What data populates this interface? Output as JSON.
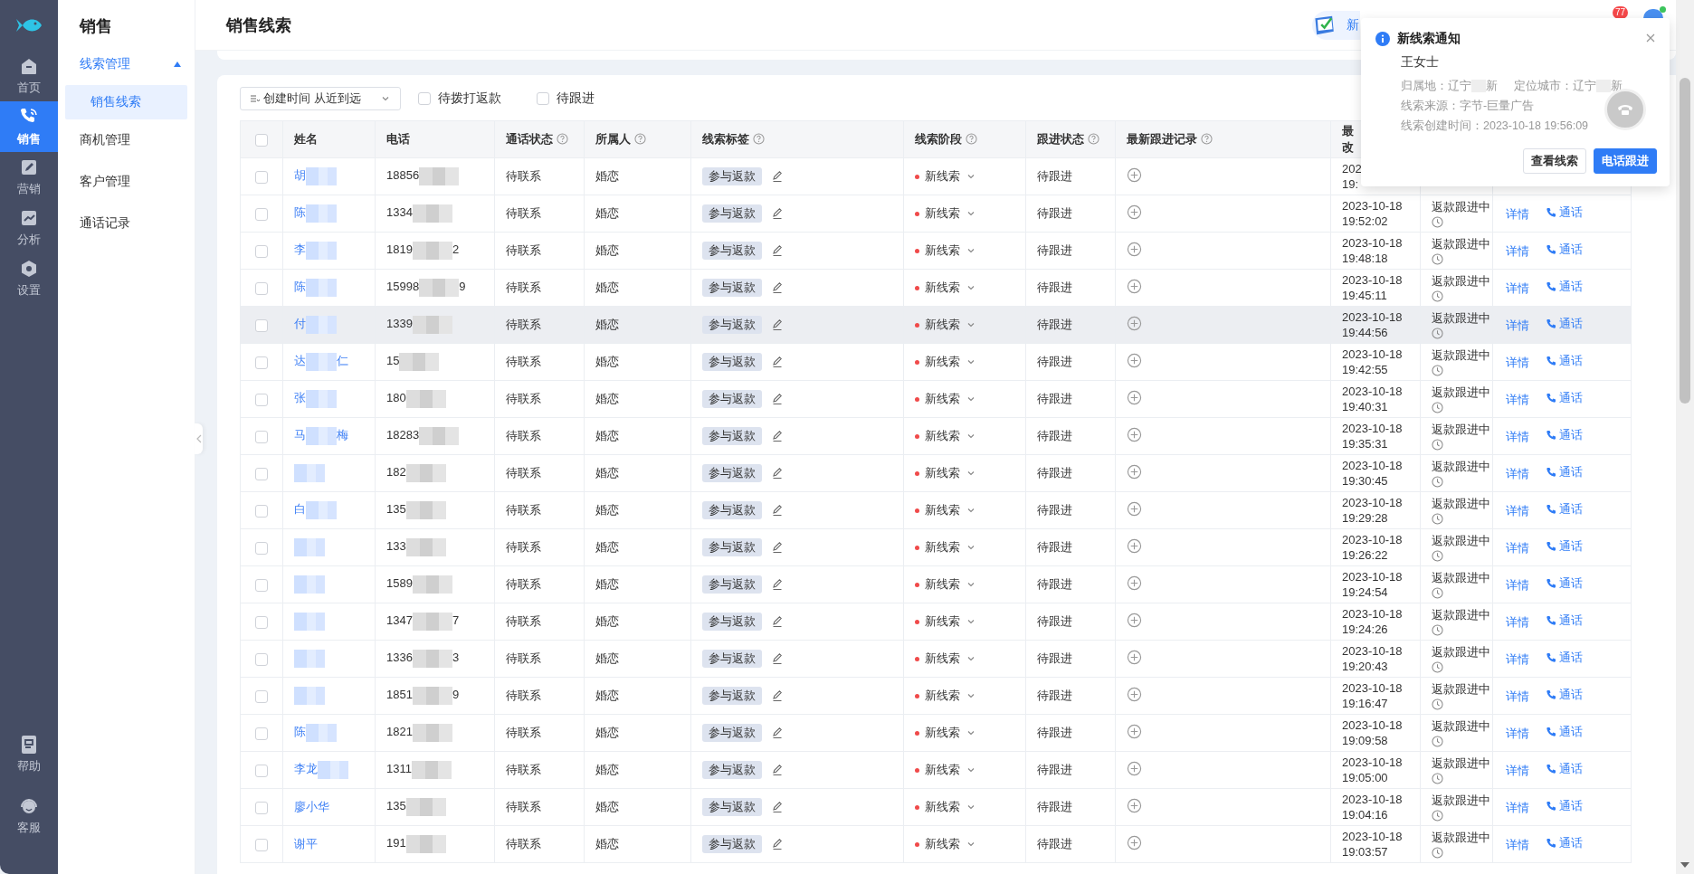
{
  "rail": {
    "items": [
      {
        "label": "首页",
        "selected": false
      },
      {
        "label": "销售",
        "selected": true
      },
      {
        "label": "营销",
        "selected": false
      },
      {
        "label": "分析",
        "selected": false
      },
      {
        "label": "设置",
        "selected": false
      }
    ],
    "bottom_items": [
      {
        "label": "帮助"
      },
      {
        "label": "客服"
      }
    ]
  },
  "subnav": {
    "title": "销售",
    "groups": [
      {
        "label": "线索管理",
        "expanded": true,
        "children": [
          {
            "label": "销售线索",
            "selected": true
          }
        ]
      },
      {
        "label": "商机管理"
      },
      {
        "label": "客户管理"
      },
      {
        "label": "通话记录"
      }
    ]
  },
  "page_title": "销售线索",
  "header": {
    "app_button": "新",
    "notification_count": "77"
  },
  "filters": {
    "sort": "创建时间 从近到远",
    "checkboxes": [
      {
        "label": "待拨打返款",
        "checked": false
      },
      {
        "label": "待跟进",
        "checked": false
      }
    ]
  },
  "table": {
    "select_all": false,
    "columns": [
      {
        "label": "姓名",
        "help": false
      },
      {
        "label": "电话",
        "help": false
      },
      {
        "label": "通话状态",
        "help": true
      },
      {
        "label": "所属人",
        "help": true
      },
      {
        "label": "线索标签",
        "help": true
      },
      {
        "label": "线索阶段",
        "help": true
      },
      {
        "label": "跟进状态",
        "help": true
      },
      {
        "label": "最新跟进记录",
        "help": true
      },
      {
        "label": "最",
        "label_2": "改",
        "help": false
      }
    ],
    "rows": [
      {
        "selected": false,
        "highlighted": false,
        "name": "胡",
        "name_redacted": true,
        "phone": "18856",
        "call_status": "待联系",
        "owner": "婚恋",
        "tag": "参与返款",
        "stage": "新线索",
        "follow_status": "待跟进",
        "modified": "202",
        "modified_time": "19:"
      },
      {
        "selected": false,
        "highlighted": false,
        "name": "陈",
        "name_redacted": true,
        "phone": "1334",
        "call_status": "待联系",
        "owner": "婚恋",
        "tag": "参与返款",
        "stage": "新线索",
        "follow_status": "待跟进",
        "modified": "2023-10-18",
        "modified_time": "19:52:02",
        "refund_status": "返款跟进中",
        "actions": [
          "详情",
          "通话"
        ]
      },
      {
        "selected": false,
        "highlighted": false,
        "name": "李",
        "name_redacted": true,
        "phone": "1819",
        "phone_tail": "2",
        "call_status": "待联系",
        "owner": "婚恋",
        "tag": "参与返款",
        "stage": "新线索",
        "follow_status": "待跟进",
        "modified": "2023-10-18",
        "modified_time": "19:48:18",
        "refund_status": "返款跟进中",
        "actions": [
          "详情",
          "通话"
        ]
      },
      {
        "selected": false,
        "highlighted": false,
        "name": "陈",
        "name_redacted": true,
        "phone": "15998",
        "phone_tail": "9",
        "call_status": "待联系",
        "owner": "婚恋",
        "tag": "参与返款",
        "stage": "新线索",
        "follow_status": "待跟进",
        "modified": "2023-10-18",
        "modified_time": "19:45:11",
        "refund_status": "返款跟进中",
        "actions": [
          "详情",
          "通话"
        ]
      },
      {
        "selected": false,
        "highlighted": true,
        "name": "付",
        "name_redacted": true,
        "phone": "1339",
        "call_status": "待联系",
        "owner": "婚恋",
        "tag": "参与返款",
        "stage": "新线索",
        "follow_status": "待跟进",
        "modified": "2023-10-18",
        "modified_time": "19:44:56",
        "refund_status": "返款跟进中",
        "actions": [
          "详情",
          "通话"
        ]
      },
      {
        "selected": false,
        "highlighted": false,
        "name": "达",
        "name_redacted": true,
        "name_tail": "仁",
        "phone": "15",
        "call_status": "待联系",
        "owner": "婚恋",
        "tag": "参与返款",
        "stage": "新线索",
        "follow_status": "待跟进",
        "modified": "2023-10-18",
        "modified_time": "19:42:55",
        "refund_status": "返款跟进中",
        "actions": [
          "详情",
          "通话"
        ]
      },
      {
        "selected": false,
        "highlighted": false,
        "name": "张",
        "name_redacted": true,
        "phone": "180",
        "call_status": "待联系",
        "owner": "婚恋",
        "tag": "参与返款",
        "stage": "新线索",
        "follow_status": "待跟进",
        "modified": "2023-10-18",
        "modified_time": "19:40:31",
        "refund_status": "返款跟进中",
        "actions": [
          "详情",
          "通话"
        ]
      },
      {
        "selected": false,
        "highlighted": false,
        "name": "马",
        "name_redacted": true,
        "name_tail": "梅",
        "phone": "18283",
        "call_status": "待联系",
        "owner": "婚恋",
        "tag": "参与返款",
        "stage": "新线索",
        "follow_status": "待跟进",
        "modified": "2023-10-18",
        "modified_time": "19:35:31",
        "refund_status": "返款跟进中",
        "actions": [
          "详情",
          "通话"
        ]
      },
      {
        "selected": false,
        "highlighted": false,
        "name_redacted": true,
        "phone": "182",
        "call_status": "待联系",
        "owner": "婚恋",
        "tag": "参与返款",
        "stage": "新线索",
        "follow_status": "待跟进",
        "modified": "2023-10-18",
        "modified_time": "19:30:45",
        "refund_status": "返款跟进中",
        "actions": [
          "详情",
          "通话"
        ]
      },
      {
        "selected": false,
        "highlighted": false,
        "name": "白",
        "name_redacted": true,
        "phone": "135",
        "call_status": "待联系",
        "owner": "婚恋",
        "tag": "参与返款",
        "stage": "新线索",
        "follow_status": "待跟进",
        "modified": "2023-10-18",
        "modified_time": "19:29:28",
        "refund_status": "返款跟进中",
        "actions": [
          "详情",
          "通话"
        ]
      },
      {
        "selected": false,
        "highlighted": false,
        "name_redacted": true,
        "phone": "133",
        "call_status": "待联系",
        "owner": "婚恋",
        "tag": "参与返款",
        "stage": "新线索",
        "follow_status": "待跟进",
        "modified": "2023-10-18",
        "modified_time": "19:26:22",
        "refund_status": "返款跟进中",
        "actions": [
          "详情",
          "通话"
        ]
      },
      {
        "selected": false,
        "highlighted": false,
        "name_redacted": true,
        "phone": "1589",
        "call_status": "待联系",
        "owner": "婚恋",
        "tag": "参与返款",
        "stage": "新线索",
        "follow_status": "待跟进",
        "modified": "2023-10-18",
        "modified_time": "19:24:54",
        "refund_status": "返款跟进中",
        "actions": [
          "详情",
          "通话"
        ]
      },
      {
        "selected": false,
        "highlighted": false,
        "name_redacted": true,
        "phone": "1347",
        "phone_tail": "7",
        "call_status": "待联系",
        "owner": "婚恋",
        "tag": "参与返款",
        "stage": "新线索",
        "follow_status": "待跟进",
        "modified": "2023-10-18",
        "modified_time": "19:24:26",
        "refund_status": "返款跟进中",
        "actions": [
          "详情",
          "通话"
        ]
      },
      {
        "selected": false,
        "highlighted": false,
        "name_redacted": true,
        "phone": "1336",
        "phone_tail": "3",
        "call_status": "待联系",
        "owner": "婚恋",
        "tag": "参与返款",
        "stage": "新线索",
        "follow_status": "待跟进",
        "modified": "2023-10-18",
        "modified_time": "19:20:43",
        "refund_status": "返款跟进中",
        "actions": [
          "详情",
          "通话"
        ]
      },
      {
        "selected": false,
        "highlighted": false,
        "name_redacted": true,
        "phone": "1851",
        "phone_tail": "9",
        "call_status": "待联系",
        "owner": "婚恋",
        "tag": "参与返款",
        "stage": "新线索",
        "follow_status": "待跟进",
        "modified": "2023-10-18",
        "modified_time": "19:16:47",
        "refund_status": "返款跟进中",
        "actions": [
          "详情",
          "通话"
        ]
      },
      {
        "selected": false,
        "highlighted": false,
        "name": "陈",
        "name_redacted": true,
        "phone": "1821",
        "call_status": "待联系",
        "owner": "婚恋",
        "tag": "参与返款",
        "stage": "新线索",
        "follow_status": "待跟进",
        "modified": "2023-10-18",
        "modified_time": "19:09:58",
        "refund_status": "返款跟进中",
        "actions": [
          "详情",
          "通话"
        ]
      },
      {
        "selected": false,
        "highlighted": false,
        "name": "李龙",
        "name_redacted": true,
        "phone": "1311",
        "call_status": "待联系",
        "owner": "婚恋",
        "tag": "参与返款",
        "stage": "新线索",
        "follow_status": "待跟进",
        "modified": "2023-10-18",
        "modified_time": "19:05:00",
        "refund_status": "返款跟进中",
        "actions": [
          "详情",
          "通话"
        ]
      },
      {
        "selected": false,
        "highlighted": false,
        "name": "廖小华",
        "name_redacted": false,
        "phone": "135",
        "call_status": "待联系",
        "owner": "婚恋",
        "tag": "参与返款",
        "stage": "新线索",
        "follow_status": "待跟进",
        "modified": "2023-10-18",
        "modified_time": "19:04:16",
        "refund_status": "返款跟进中",
        "actions": [
          "详情",
          "通话"
        ]
      },
      {
        "selected": false,
        "highlighted": false,
        "name": "谢平",
        "name_redacted": false,
        "phone": "191",
        "call_status": "待联系",
        "owner": "婚恋",
        "tag": "参与返款",
        "stage": "新线索",
        "follow_status": "待跟进",
        "modified": "2023-10-18",
        "modified_time": "19:03:57",
        "refund_status": "返款跟进中",
        "actions": [
          "详情",
          "通话"
        ]
      }
    ]
  },
  "notification": {
    "title": "新线索通知",
    "contact": "王女士",
    "home_location": "归属地：辽宁",
    "home_location_tail": "新",
    "city": "定位城市：辽宁",
    "city_tail": "新",
    "source": "线索来源：字节-巨量广告",
    "created": "线索创建时间：2023-10-18 19:56:09",
    "buttons": [
      "查看线索",
      "电话跟进"
    ]
  }
}
